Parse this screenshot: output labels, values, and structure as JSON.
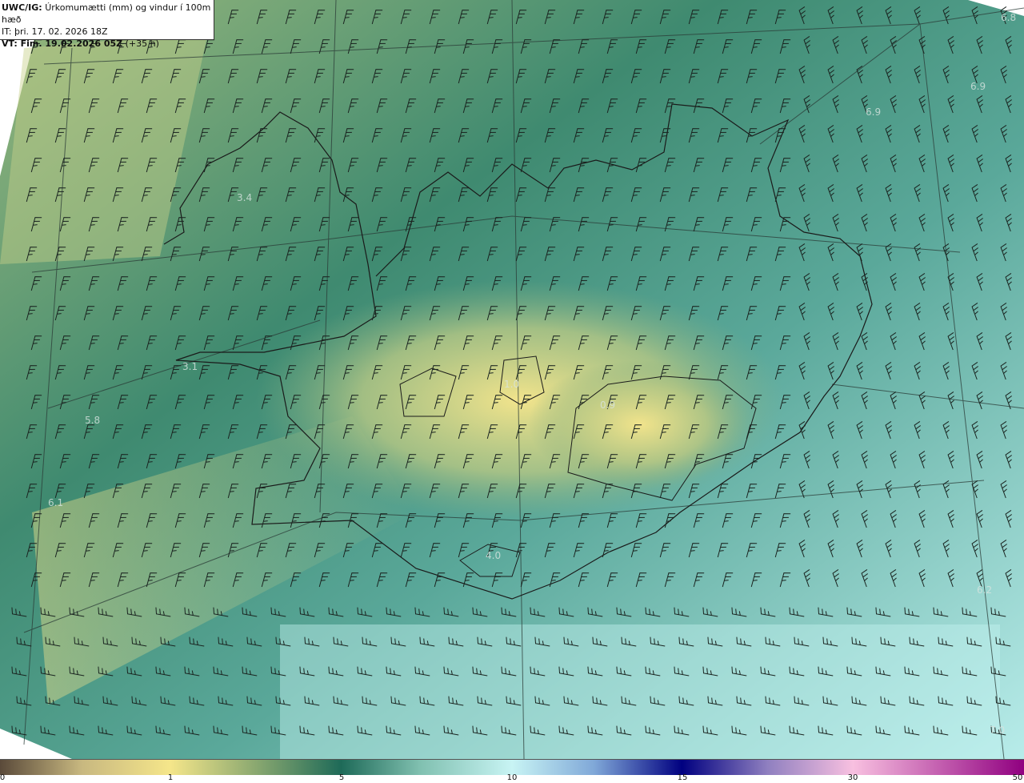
{
  "header": {
    "model": "UWC/IG:",
    "title": "Úrkomumætti (mm) og vindur í 100m hæð",
    "initial_time": "IT: þri. 17. 02. 2026 18Z",
    "valid_label": "VT: Fim. 19.02.2026 05Z",
    "lead_time": "(+35 h)"
  },
  "point_values": [
    "3.4",
    "3.1",
    "5.8",
    "6.1",
    "4.0",
    "1.0",
    "0.9",
    "6.9",
    "6.9",
    "6.8",
    "6.2",
    "7.0"
  ],
  "colorbar": {
    "labels": [
      "0",
      "1",
      "5",
      "10",
      "15",
      "30",
      "50"
    ]
  },
  "colors": {
    "coast": "#1a1a1a",
    "land_dry": "#f0e28a",
    "sea": "#6fb8a8"
  }
}
